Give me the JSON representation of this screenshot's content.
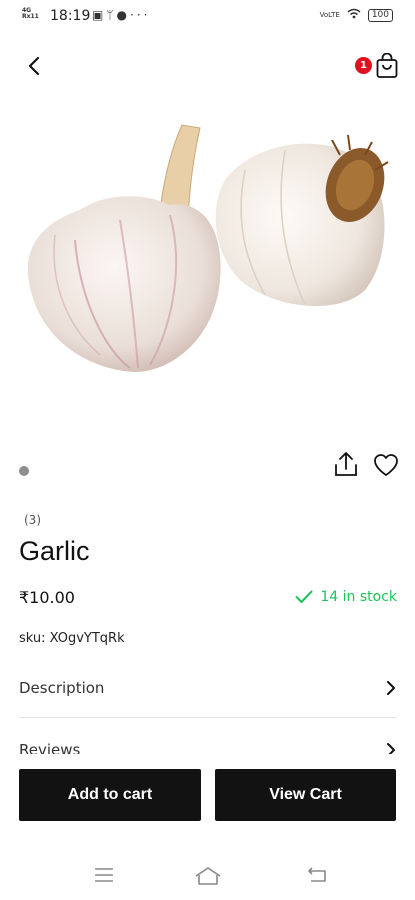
{
  "status_bar": {
    "network_top": "4G",
    "network_bottom": "Rx11",
    "time": "18:19",
    "network_type_right": "VoLTE",
    "battery": "100",
    "notification_icons": [
      "gallery-icon",
      "usb-icon",
      "chat-icon",
      "more-dots-icon"
    ]
  },
  "top_bar": {
    "cart_badge_count": "1"
  },
  "product": {
    "rating_count": "(3)",
    "name": "Garlic",
    "price": "₹10.00",
    "stock": "14 in stock",
    "sku": "sku: XOgvYTqRk",
    "image_alt": "garlic bulbs"
  },
  "accordion": {
    "description_label": "Description",
    "reviews_label": "Reviews"
  },
  "actions": {
    "add_to_cart_label": "Add to cart",
    "view_cart_label": "View Cart"
  },
  "colors": {
    "primary_button": "#121212",
    "stock_green": "#1ec35a",
    "badge_red": "#e0101f"
  }
}
